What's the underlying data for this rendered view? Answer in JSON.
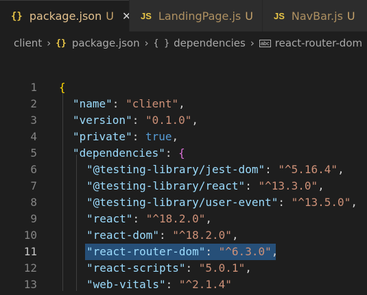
{
  "tabs": [
    {
      "icon": "{}",
      "name": "package.json",
      "status": "U",
      "active": true
    },
    {
      "icon": "JS",
      "name": "LandingPage.js",
      "status": "U",
      "active": false
    },
    {
      "icon": "JS",
      "name": "NavBar.js",
      "status": "U",
      "active": false
    }
  ],
  "close_glyph": "✕",
  "breadcrumb": [
    "client",
    "package.json",
    "dependencies",
    "react-router-dom"
  ],
  "breadcrumb_icons": {
    "json": "{}",
    "object": "{ }",
    "string": "abc"
  },
  "current_line": 11,
  "lines": [
    {
      "num": "1",
      "parts": [
        {
          "c": "br1",
          "t": "{"
        }
      ]
    },
    {
      "num": "2",
      "parts": [
        {
          "c": "k",
          "t": "\"name\""
        },
        {
          "c": "p",
          "t": ": "
        },
        {
          "c": "s",
          "t": "\"client\""
        },
        {
          "c": "p",
          "t": ","
        }
      ]
    },
    {
      "num": "3",
      "parts": [
        {
          "c": "k",
          "t": "\"version\""
        },
        {
          "c": "p",
          "t": ": "
        },
        {
          "c": "s",
          "t": "\"0.1.0\""
        },
        {
          "c": "p",
          "t": ","
        }
      ]
    },
    {
      "num": "4",
      "parts": [
        {
          "c": "k",
          "t": "\"private\""
        },
        {
          "c": "p",
          "t": ": "
        },
        {
          "c": "b",
          "t": "true"
        },
        {
          "c": "p",
          "t": ","
        }
      ]
    },
    {
      "num": "5",
      "parts": [
        {
          "c": "k",
          "t": "\"dependencies\""
        },
        {
          "c": "p",
          "t": ": "
        },
        {
          "c": "br2",
          "t": "{"
        }
      ]
    },
    {
      "num": "6",
      "parts": [
        {
          "c": "k",
          "t": "\"@testing-library/jest-dom\""
        },
        {
          "c": "p",
          "t": ": "
        },
        {
          "c": "s",
          "t": "\"^5.16.4\""
        },
        {
          "c": "p",
          "t": ","
        }
      ]
    },
    {
      "num": "7",
      "parts": [
        {
          "c": "k",
          "t": "\"@testing-library/react\""
        },
        {
          "c": "p",
          "t": ": "
        },
        {
          "c": "s",
          "t": "\"^13.3.0\""
        },
        {
          "c": "p",
          "t": ","
        }
      ]
    },
    {
      "num": "8",
      "parts": [
        {
          "c": "k",
          "t": "\"@testing-library/user-event\""
        },
        {
          "c": "p",
          "t": ": "
        },
        {
          "c": "s",
          "t": "\"^13.5.0\""
        },
        {
          "c": "p",
          "t": ","
        }
      ]
    },
    {
      "num": "9",
      "parts": [
        {
          "c": "k",
          "t": "\"react\""
        },
        {
          "c": "p",
          "t": ": "
        },
        {
          "c": "s",
          "t": "\"^18.2.0\""
        },
        {
          "c": "p",
          "t": ","
        }
      ]
    },
    {
      "num": "10",
      "parts": [
        {
          "c": "k",
          "t": "\"react-dom\""
        },
        {
          "c": "p",
          "t": ": "
        },
        {
          "c": "s",
          "t": "\"^18.2.0\""
        },
        {
          "c": "p",
          "t": ","
        }
      ]
    },
    {
      "num": "11",
      "parts": [
        {
          "c": "k",
          "t": "\"react-router-dom\""
        },
        {
          "c": "p",
          "t": ": "
        },
        {
          "c": "s",
          "t": "\"^6.3.0\""
        },
        {
          "c": "p",
          "t": ","
        }
      ]
    },
    {
      "num": "12",
      "parts": [
        {
          "c": "k",
          "t": "\"react-scripts\""
        },
        {
          "c": "p",
          "t": ": "
        },
        {
          "c": "s",
          "t": "\"5.0.1\""
        },
        {
          "c": "p",
          "t": ","
        }
      ]
    },
    {
      "num": "13",
      "parts": [
        {
          "c": "k",
          "t": "\"web-vitals\""
        },
        {
          "c": "p",
          "t": ": "
        },
        {
          "c": "s",
          "t": "\"^2.1.4\""
        }
      ]
    }
  ],
  "colors": {
    "key": "#9cdcfe",
    "string": "#ce9178",
    "boolean": "#569cd6",
    "selection": "#264f78",
    "icon_yellow": "#e8c547",
    "untracked": "#c5a26b"
  }
}
